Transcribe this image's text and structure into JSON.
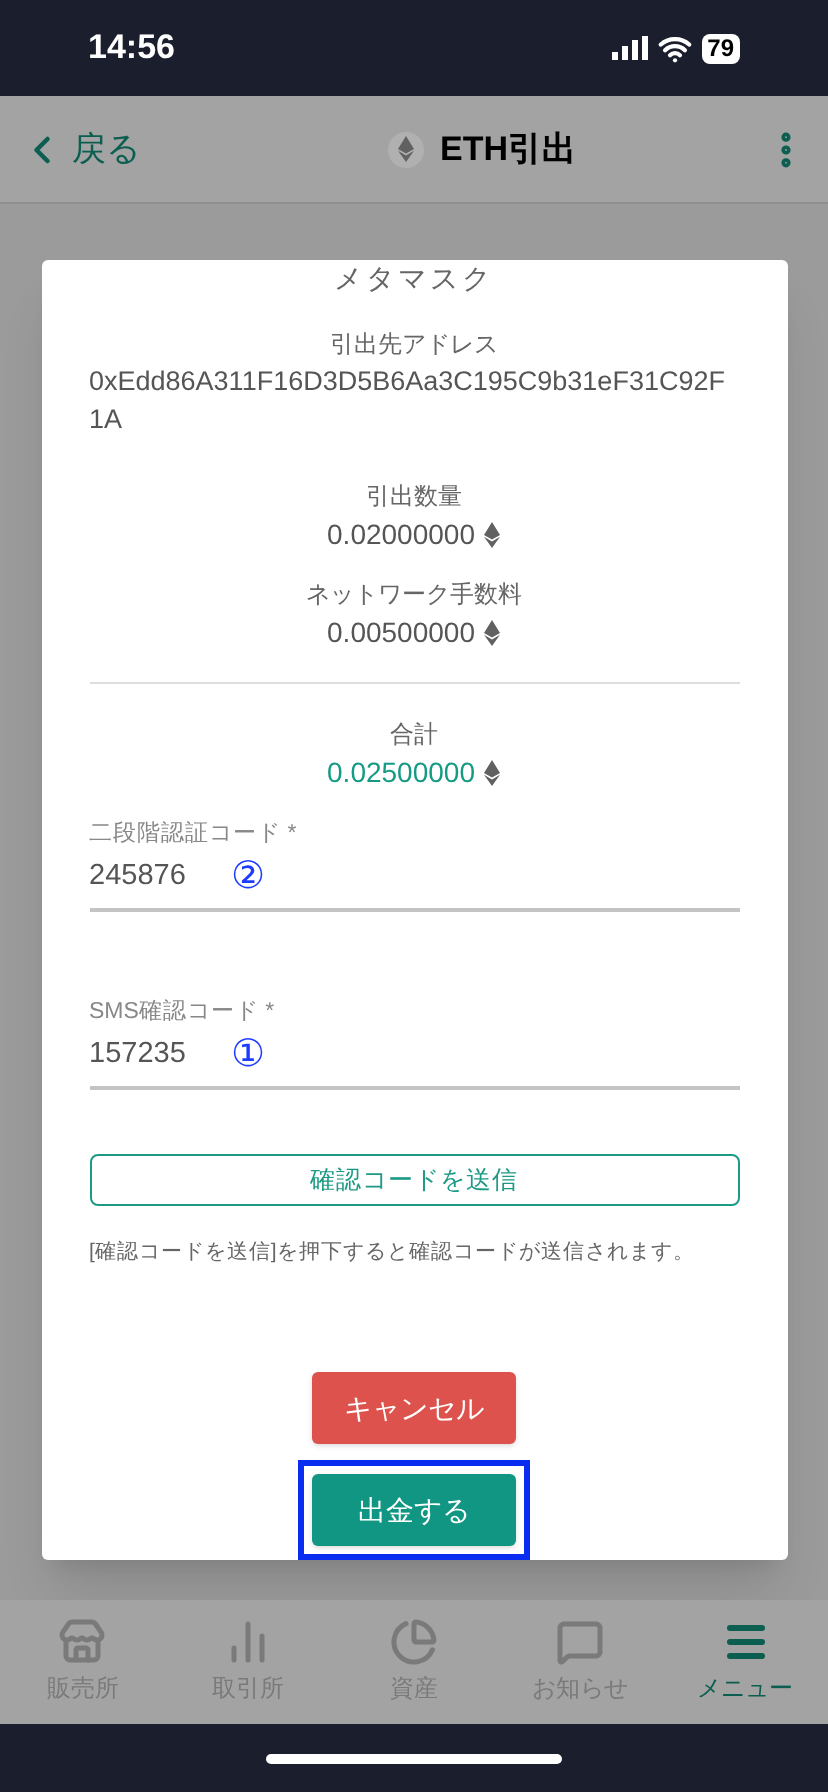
{
  "status_bar": {
    "time": "14:56",
    "battery": "79"
  },
  "header": {
    "back": "戻る",
    "title": "ETH引出"
  },
  "dialog": {
    "title": "メタマスク",
    "address": {
      "label": "引出先アドレス",
      "value": "0xEdd86A311F16D3D5B6Aa3C195C9b31eF31C92F1A"
    },
    "amounts": [
      {
        "label": "引出数量",
        "value": "0.02000000",
        "kind": "plain"
      },
      {
        "label": "ネットワーク手数料",
        "value": "0.00500000",
        "kind": "plain"
      },
      {
        "label": "合計",
        "value": "0.02500000",
        "kind": "total"
      }
    ],
    "fields": [
      {
        "label": "二段階認証コード *",
        "value": "245876",
        "annotation": "②"
      },
      {
        "label": "SMS確認コード *",
        "value": "157235",
        "annotation": "①"
      }
    ],
    "send_code_button": "確認コードを送信",
    "note": "[確認コードを送信]を押下すると確認コードが送信されます。",
    "buttons": [
      {
        "label": "キャンセル",
        "kind": "cancel",
        "highlighted": false
      },
      {
        "label": "出金する",
        "kind": "submit",
        "highlighted": true
      }
    ]
  },
  "nav": [
    {
      "label": "販売所",
      "selected": false
    },
    {
      "label": "取引所",
      "selected": false
    },
    {
      "label": "資産",
      "selected": false
    },
    {
      "label": "お知らせ",
      "selected": false
    },
    {
      "label": "メニュー",
      "selected": true
    }
  ]
}
